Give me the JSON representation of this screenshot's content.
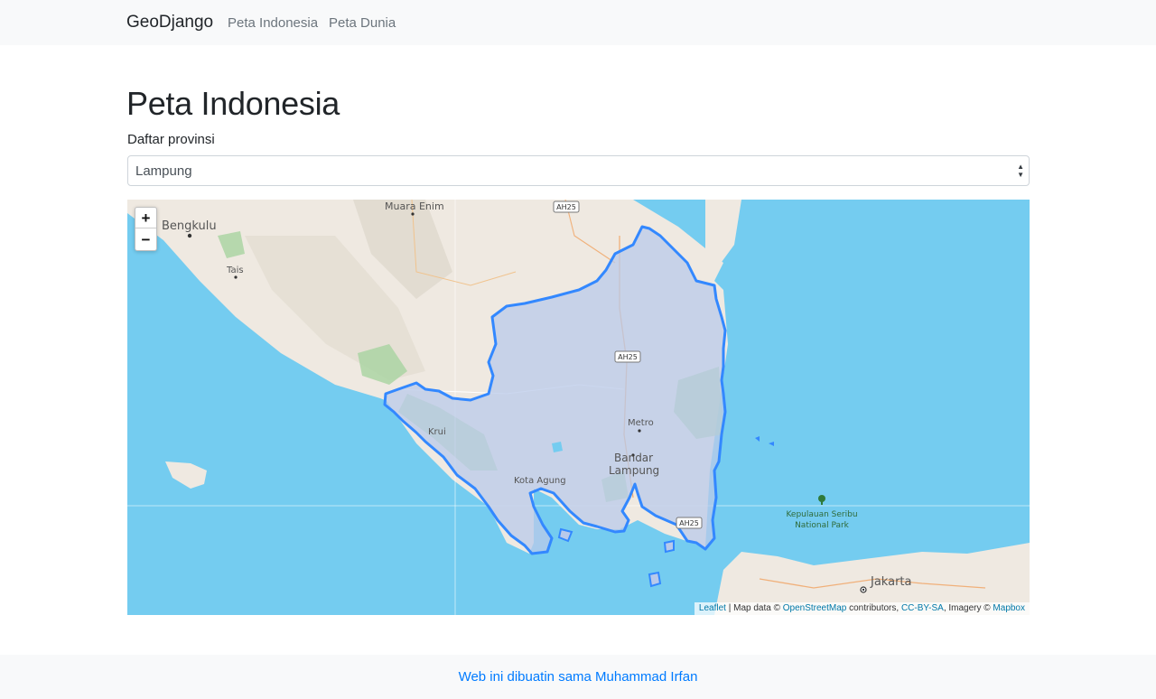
{
  "navbar": {
    "brand": "GeoDjango",
    "links": [
      "Peta Indonesia",
      "Peta Dunia"
    ]
  },
  "page": {
    "title": "Peta Indonesia",
    "select_label": "Daftar provinsi",
    "selected_province": "Lampung"
  },
  "map": {
    "zoom_in": "+",
    "zoom_out": "−",
    "place_labels": {
      "bengkulu": "Bengkulu",
      "tais": "Tais",
      "muara_enim": "Muara Enim",
      "metro": "Metro",
      "bandar": "Bandar",
      "lampung": "Lampung",
      "kota_agung": "Kota Agung",
      "krui": "Krui",
      "jakarta": "Jakarta",
      "kepulauan": "Kepulauan Seribu",
      "national_park": "National Park"
    },
    "road_shields": [
      "AH25",
      "AH25",
      "AH25"
    ],
    "attribution": {
      "leaflet": "Leaflet",
      "map_data": "| Map data ©",
      "osm": "OpenStreetMap",
      "contributors": "contributors,",
      "license": "CC-BY-SA",
      "imagery": ", Imagery ©",
      "mapbox": "Mapbox"
    },
    "colors": {
      "sea": "#74ccf0",
      "land": "#efe9e1",
      "park": "#a7d3a0",
      "highlight_fill": "#c7d3ec",
      "highlight_stroke": "#3388ff"
    }
  },
  "footer": {
    "text": "Web ini dibuatin sama Muhammad Irfan"
  }
}
